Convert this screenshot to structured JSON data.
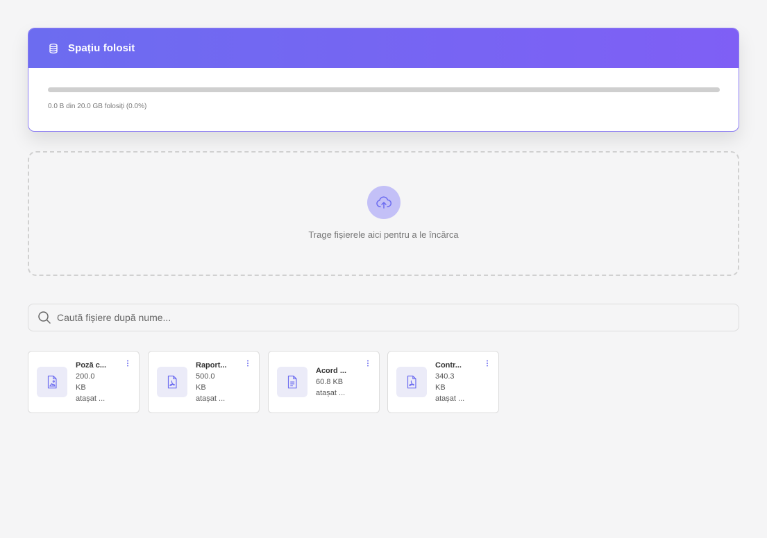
{
  "storage": {
    "title": "Spațiu folosit",
    "usage_text": "0.0 B din 20.0 GB folosiți (0.0%)",
    "percent_used": 0,
    "accent_color": "#7f5ff5"
  },
  "dropzone": {
    "text": "Trage fișierele aici pentru a le încărca",
    "icon": "cloud-upload-icon"
  },
  "search": {
    "placeholder": "Caută fișiere după nume..."
  },
  "files": [
    {
      "name": "Poză c...",
      "size": "200.0 KB",
      "meta": "atașat ...",
      "icon": "image-file-icon"
    },
    {
      "name": "Raport...",
      "size": "500.0 KB",
      "meta": "atașat ...",
      "icon": "pdf-file-icon"
    },
    {
      "name": "Acord ...",
      "size": "60.8 KB",
      "meta": "atașat ...",
      "icon": "text-file-icon"
    },
    {
      "name": "Contr...",
      "size": "340.3 KB",
      "meta": "atașat ...",
      "icon": "pdf-file-icon"
    }
  ]
}
